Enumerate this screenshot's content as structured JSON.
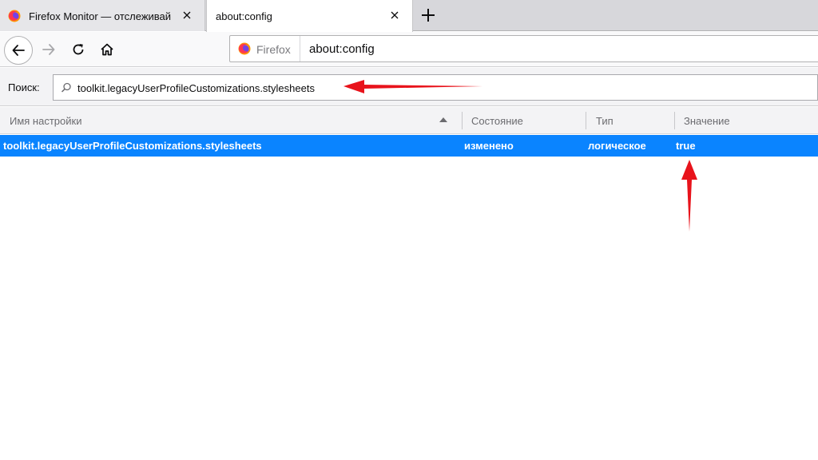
{
  "tabs": [
    {
      "title": "Firefox Monitor — отслеживай",
      "icon": "firefox-logo-icon",
      "active": false
    },
    {
      "title": "about:config",
      "active": true
    }
  ],
  "toolbar": {
    "identity_label": "Firefox",
    "url": "about:config"
  },
  "search": {
    "label": "Поиск:",
    "value": "toolkit.legacyUserProfileCustomizations.stylesheets"
  },
  "table": {
    "columns": [
      "Имя настройки",
      "Состояние",
      "Тип",
      "Значение"
    ],
    "sort_column": "Имя настройки",
    "sort_direction": "ascending",
    "rows": [
      {
        "name": "toolkit.legacyUserProfileCustomizations.stylesheets",
        "status": "изменено",
        "type": "логическое",
        "value": "true",
        "selected": true
      }
    ]
  },
  "colors": {
    "selection": "#0a84ff",
    "annotation_arrow": "#e8131b",
    "firefox_orange": "#ff7139"
  }
}
